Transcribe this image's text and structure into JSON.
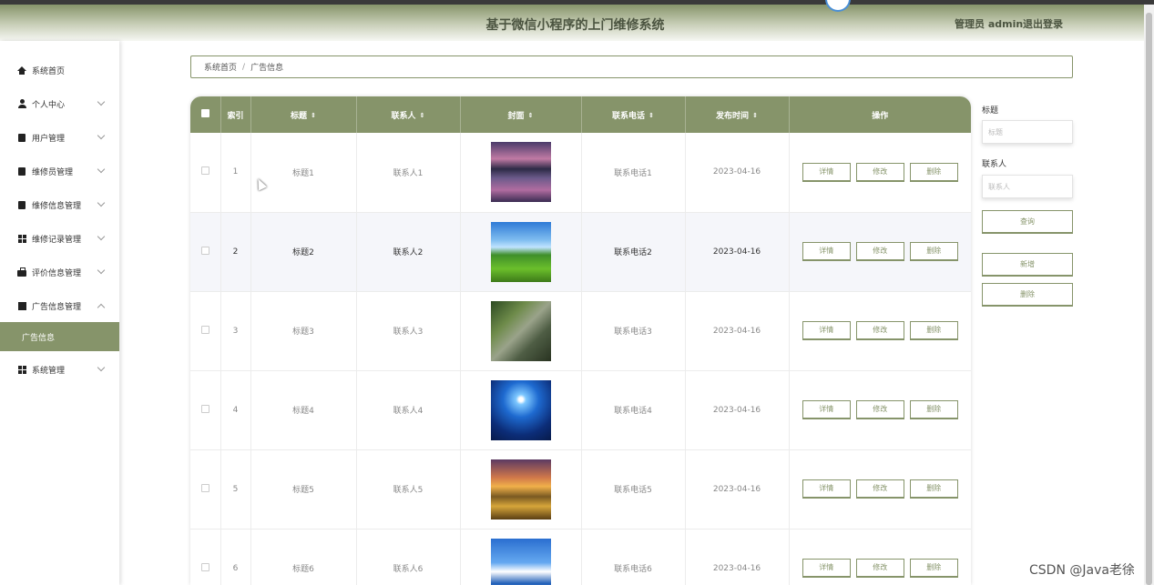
{
  "header": {
    "title": "基于微信小程序的上门维修系统",
    "user": "管理员 admin",
    "logout": "退出登录"
  },
  "sidebar": {
    "items": [
      {
        "label": "系统首页",
        "icon": "home-icon",
        "expandable": false
      },
      {
        "label": "个人中心",
        "icon": "user-icon",
        "expandable": true
      },
      {
        "label": "用户管理",
        "icon": "box-icon",
        "expandable": true
      },
      {
        "label": "维修员管理",
        "icon": "box-icon",
        "expandable": true
      },
      {
        "label": "维修信息管理",
        "icon": "box-icon",
        "expandable": true
      },
      {
        "label": "维修记录管理",
        "icon": "grid-icon",
        "expandable": true
      },
      {
        "label": "评价信息管理",
        "icon": "briefcase-icon",
        "expandable": true
      },
      {
        "label": "广告信息管理",
        "icon": "chart-icon",
        "expandable": true,
        "expanded": true
      },
      {
        "label": "系统管理",
        "icon": "grid-icon",
        "expandable": true
      }
    ],
    "active_sub": "广告信息"
  },
  "breadcrumb": {
    "home": "系统首页",
    "separator": "/",
    "current": "广告信息"
  },
  "table": {
    "columns": [
      "索引",
      "标题",
      "联系人",
      "封面",
      "联系电话",
      "发布时间",
      "操作"
    ],
    "rows": [
      {
        "index": "1",
        "title": "标题1",
        "contact": "联系人1",
        "phone": "联系电话1",
        "date": "2023-04-16"
      },
      {
        "index": "2",
        "title": "标题2",
        "contact": "联系人2",
        "phone": "联系电话2",
        "date": "2023-04-16"
      },
      {
        "index": "3",
        "title": "标题3",
        "contact": "联系人3",
        "phone": "联系电话3",
        "date": "2023-04-16"
      },
      {
        "index": "4",
        "title": "标题4",
        "contact": "联系人4",
        "phone": "联系电话4",
        "date": "2023-04-16"
      },
      {
        "index": "5",
        "title": "标题5",
        "contact": "联系人5",
        "phone": "联系电话5",
        "date": "2023-04-16"
      },
      {
        "index": "6",
        "title": "标题6",
        "contact": "联系人6",
        "phone": "联系电话6",
        "date": "2023-04-16"
      }
    ],
    "actions": {
      "detail": "详情",
      "edit": "修改",
      "delete": "删除"
    }
  },
  "search": {
    "title_label": "标题",
    "title_placeholder": "标题",
    "contact_label": "联系人",
    "contact_placeholder": "联系人",
    "query": "查询",
    "add": "新增",
    "delete": "删除"
  },
  "watermark": "CSDN @Java老徐",
  "colors": {
    "accent": "#86946a",
    "header_text": "#4b5440"
  }
}
